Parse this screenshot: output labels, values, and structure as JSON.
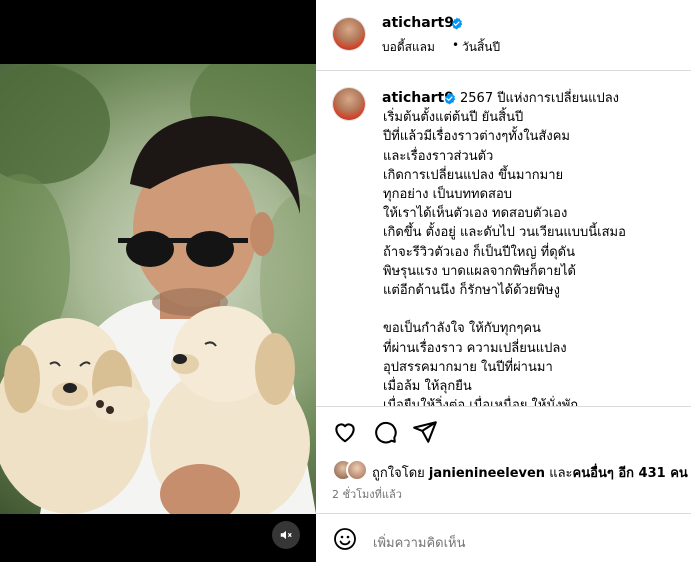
{
  "post": {
    "username": "atichart9",
    "subline_audio": "บอดี้สแลม",
    "subline_separator": "•",
    "subline_song": "วันสิ้นปี",
    "caption_username": "atichart9",
    "caption": "2567 ปีแห่งการเปลี่ยนแปลง\nเริ่มต้นตั้งแต่ต้นปี ยันสิ้นปี\nปีที่แล้วมีเรื่องราวต่างๆทั้งในสังคม\nและเรื่องราวส่วนตัว\nเกิดการเปลี่ยนแปลง ขึ้นมากมาย\nทุกอย่าง เป็นบททดสอบ\nให้เราได้เห็นตัวเอง ทดสอบตัวเอง\nเกิดขึ้น ตั้งอยู่ และดับไป วนเวียนแบบนี้เสมอ\nถ้าจะรีวิวตัวเอง ก็เป็นปีใหญ่ ที่ดุดัน\nพิษรุนแรง บาดแผลจากพิษก็ตายได้\nแต่อีกด้านนึง ก็รักษาได้ด้วยพิษงู\n\nขอเป็นกำลังใจ ให้กับทุกๆคน\nที่ผ่านเรื่องราว ความเปลี่ยนแปลง\nอุปสรรคมากมาย ในปีที่ผ่านมา\nเมื่อล้ม ให้ลุกยืน\nเมื่อยืนให้วิ่งต่อ เมื่อเหนื่อย ให้นั่งพัก",
    "likes_prefix": "ถูกใจโดย ",
    "likes_user": "janienineeleven",
    "likes_middle": " และ",
    "likes_others": "คนอื่นๆ อีก 431 คน",
    "time_ago": "2 ชั่วโมงที่แล้ว",
    "comment_placeholder": "เพิ่มความคิดเห็น"
  },
  "icons": {
    "verified": "verified-badge-icon",
    "like": "heart-icon",
    "comment": "comment-bubble-icon",
    "share": "paper-plane-icon",
    "emoji": "smiley-icon",
    "mute": "speaker-muted-icon"
  },
  "colors": {
    "verified": "#0095f6",
    "divider": "#dbdbdb",
    "secondary_text": "#737373"
  }
}
